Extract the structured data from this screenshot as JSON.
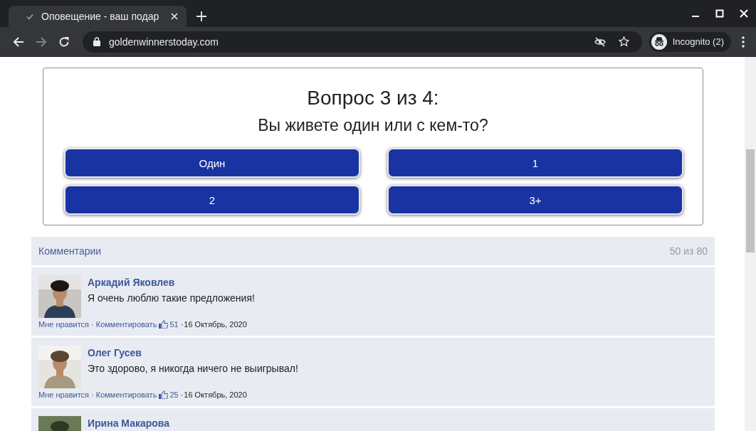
{
  "browser": {
    "tab": {
      "title": "Оповещение - ваш подар",
      "selected": true
    },
    "url": "goldenwinnerstoday.com",
    "profile": "Incognito (2)"
  },
  "quiz": {
    "title": "Вопрос 3 из 4:",
    "question": "Вы живете один или с кем-то?",
    "answers": [
      "Один",
      "1",
      "2",
      "3+"
    ]
  },
  "comments": {
    "header": "Комментарии",
    "count": "50 из 80",
    "separator": "·",
    "items": [
      {
        "name": "Аркадий Яковлев",
        "text": "Я очень люблю такие предложения!",
        "like": "Мне нравится",
        "reply": "Комментировать",
        "likes": "51",
        "date": "16 Октябрь, 2020"
      },
      {
        "name": "Олег Гусев",
        "text": "Это здорово, я никогда ничего не выигрывал!",
        "like": "Мне нравится",
        "reply": "Комментировать",
        "likes": "25",
        "date": "16 Октябрь, 2020"
      },
      {
        "name": "Ирина Макарова"
      }
    ]
  }
}
